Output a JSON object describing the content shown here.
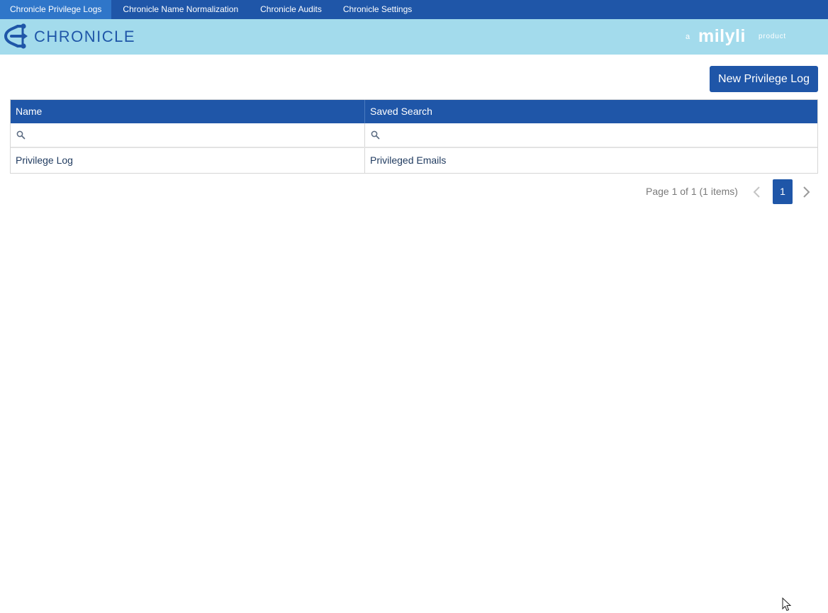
{
  "topnav": {
    "tabs": [
      {
        "label": "Chronicle Privilege Logs",
        "active": true
      },
      {
        "label": "Chronicle Name Normalization",
        "active": false
      },
      {
        "label": "Chronicle Audits",
        "active": false
      },
      {
        "label": "Chronicle Settings",
        "active": false
      }
    ]
  },
  "brand": {
    "logo_text": "CHRONICLE",
    "vendor_prefix": "a",
    "vendor_name": "milyli",
    "vendor_suffix": "product"
  },
  "toolbar": {
    "new_label": "New Privilege Log"
  },
  "grid": {
    "columns": [
      "Name",
      "Saved Search"
    ],
    "filters": [
      {
        "value": "",
        "icon": "search-icon"
      },
      {
        "value": "",
        "icon": "search-icon"
      }
    ],
    "rows": [
      [
        "Privilege Log",
        "Privileged Emails"
      ]
    ]
  },
  "pager": {
    "info": "Page 1 of 1 (1 items)",
    "current_page": "1",
    "prev_icon": "chevron-left-icon",
    "next_icon": "chevron-right-icon"
  },
  "colors": {
    "primary": "#1f56a8",
    "active_tab": "#2f76c9",
    "brand_bar": "#a3dbec"
  }
}
